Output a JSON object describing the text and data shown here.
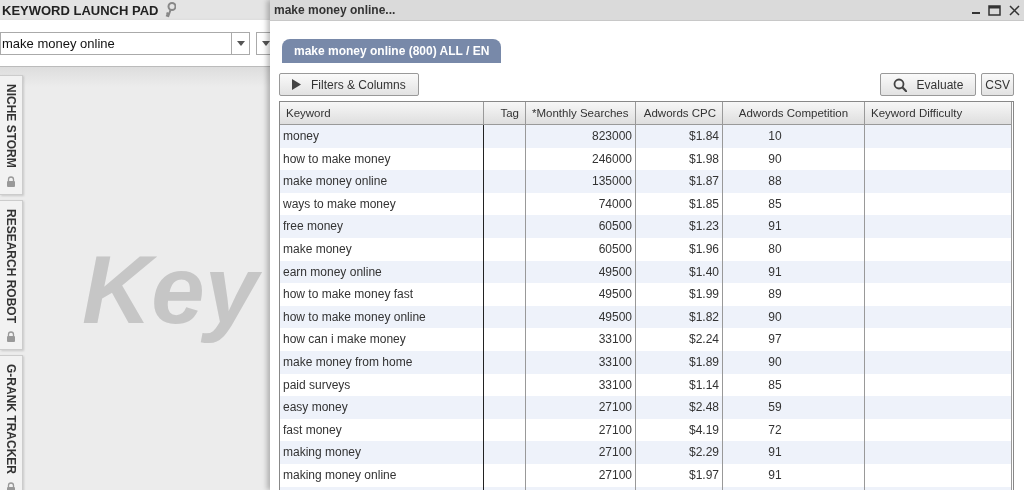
{
  "launch_pad": {
    "title": "KEYWORD LAUNCH PAD",
    "search": {
      "value": "make money online"
    },
    "background_logo": "Key"
  },
  "side_tabs": [
    {
      "label": "NICHE STORM",
      "locked": true
    },
    {
      "label": "RESEARCH ROBOT",
      "locked": true
    },
    {
      "label": "G-RANK TRACKER",
      "locked": true
    }
  ],
  "window": {
    "title": "make money online...",
    "tab": {
      "label": "make money online (800) ALL / EN",
      "selected": true
    },
    "buttons": {
      "filters": "Filters & Columns",
      "evaluate": "Evaluate",
      "csv": "CSV"
    },
    "table": {
      "columns": [
        "Keyword",
        "Tag",
        "*Monthly Searches",
        "Adwords CPC",
        "Adwords Competition",
        "Keyword Difficulty"
      ],
      "rows": [
        [
          "money",
          "",
          "823000",
          "$1.84",
          "10",
          ""
        ],
        [
          "how to make money",
          "",
          "246000",
          "$1.98",
          "90",
          ""
        ],
        [
          "make money online",
          "",
          "135000",
          "$1.87",
          "88",
          ""
        ],
        [
          "ways to make money",
          "",
          "74000",
          "$1.85",
          "85",
          ""
        ],
        [
          "free money",
          "",
          "60500",
          "$1.23",
          "91",
          ""
        ],
        [
          "make money",
          "",
          "60500",
          "$1.96",
          "80",
          ""
        ],
        [
          "earn money online",
          "",
          "49500",
          "$1.40",
          "91",
          ""
        ],
        [
          "how to make money fast",
          "",
          "49500",
          "$1.99",
          "89",
          ""
        ],
        [
          "how to make money online",
          "",
          "49500",
          "$1.82",
          "90",
          ""
        ],
        [
          "how can i make money",
          "",
          "33100",
          "$2.24",
          "97",
          ""
        ],
        [
          "make money from home",
          "",
          "33100",
          "$1.89",
          "90",
          ""
        ],
        [
          "paid surveys",
          "",
          "33100",
          "$1.14",
          "85",
          ""
        ],
        [
          "easy money",
          "",
          "27100",
          "$2.48",
          "59",
          ""
        ],
        [
          "fast money",
          "",
          "27100",
          "$4.19",
          "72",
          ""
        ],
        [
          "making money",
          "",
          "27100",
          "$2.29",
          "91",
          ""
        ],
        [
          "making money online",
          "",
          "27100",
          "$1.97",
          "91",
          ""
        ]
      ]
    }
  }
}
